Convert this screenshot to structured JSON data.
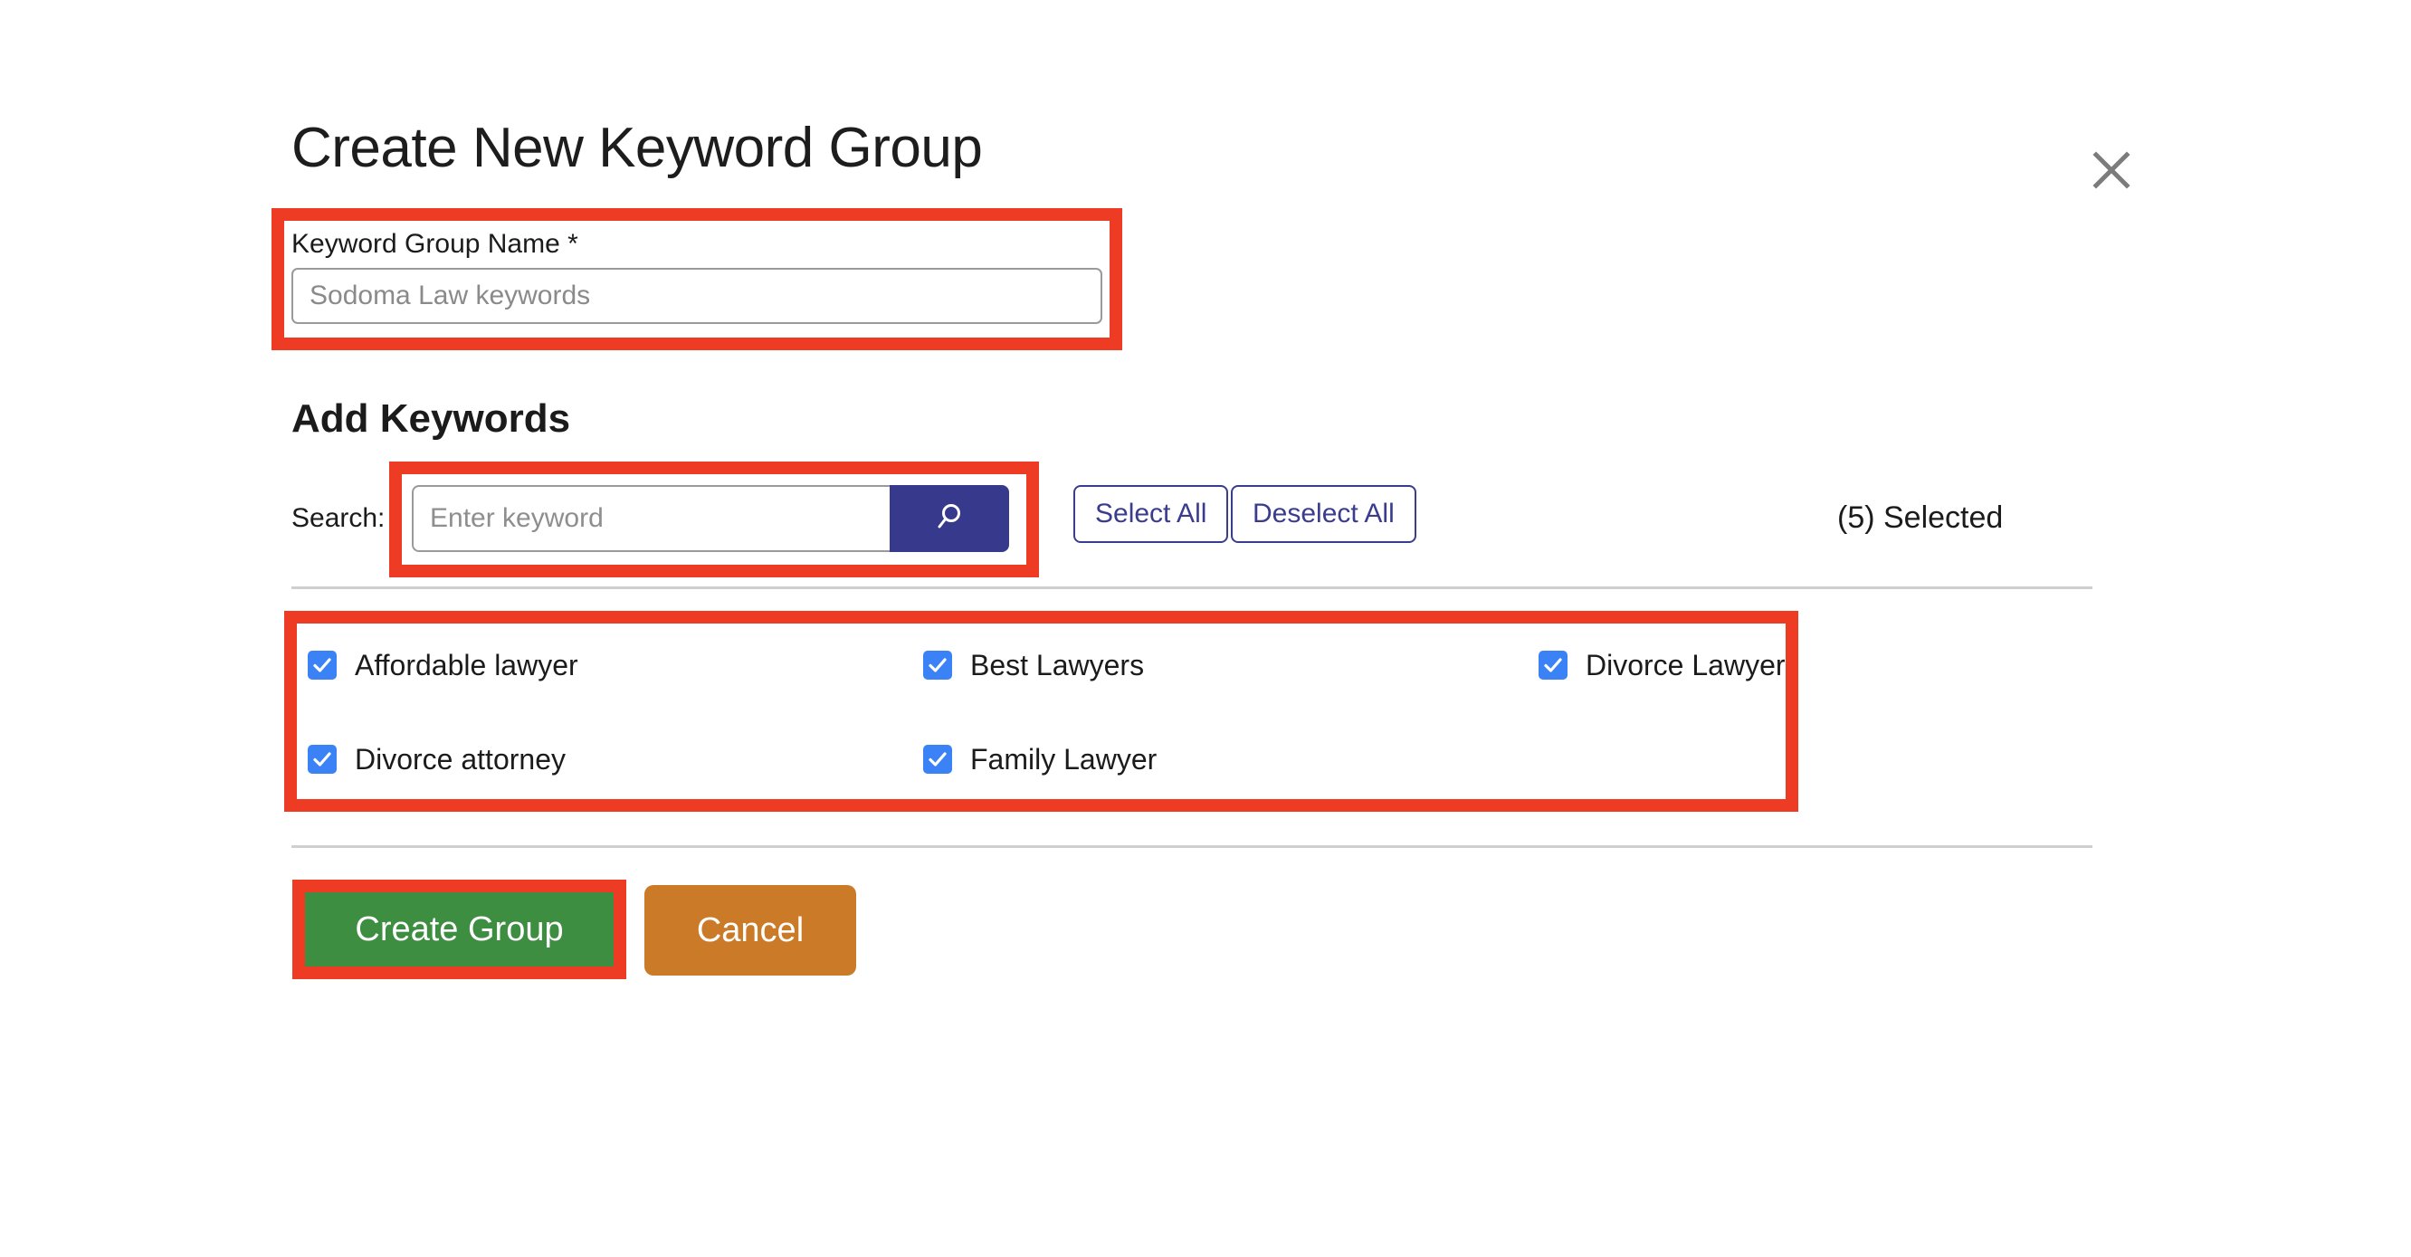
{
  "dialog": {
    "title": "Create New Keyword Group",
    "close_icon": "close-icon"
  },
  "name_field": {
    "label": "Keyword Group Name *",
    "value": "Sodoma Law keywords",
    "placeholder": "Sodoma Law keywords"
  },
  "add_keywords": {
    "heading": "Add Keywords",
    "search": {
      "label": "Search:",
      "value": "",
      "placeholder": "Enter keyword",
      "submit_icon": "search-icon"
    },
    "select_all_label": "Select All",
    "deselect_all_label": "Deselect All",
    "selected_count_text": "(5) Selected",
    "keywords": [
      {
        "label": "Affordable lawyer",
        "checked": true,
        "col": 0,
        "row": 0
      },
      {
        "label": "Best Lawyers",
        "checked": true,
        "col": 1,
        "row": 0
      },
      {
        "label": "Divorce Lawyer",
        "checked": true,
        "col": 2,
        "row": 0
      },
      {
        "label": "Divorce attorney",
        "checked": true,
        "col": 0,
        "row": 1
      },
      {
        "label": "Family Lawyer",
        "checked": true,
        "col": 1,
        "row": 1
      }
    ]
  },
  "actions": {
    "create_label": "Create Group",
    "cancel_label": "Cancel"
  },
  "colors": {
    "annotation_red": "#ee3b23",
    "primary_navy": "#373a8c",
    "checkbox_blue": "#3b82f6",
    "create_green": "#3e8e41",
    "cancel_orange": "#cb7b28",
    "divider_gray": "#cfcfcf"
  }
}
